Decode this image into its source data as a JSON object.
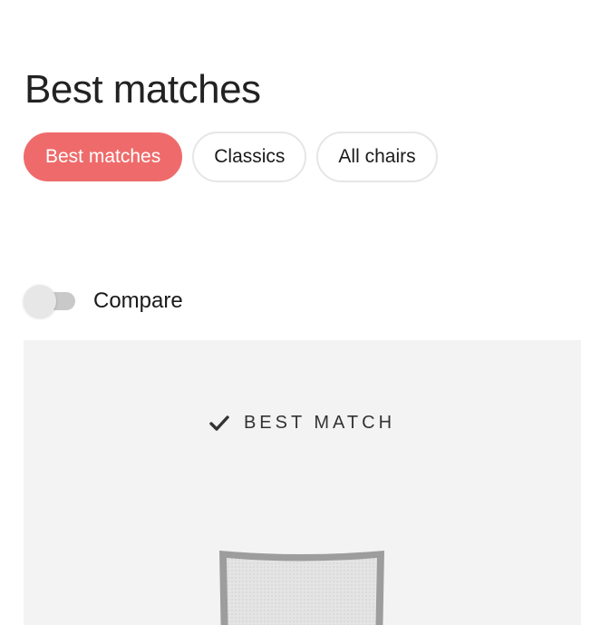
{
  "page": {
    "title": "Best matches"
  },
  "filters": {
    "tabs": [
      {
        "label": "Best matches",
        "active": true
      },
      {
        "label": "Classics",
        "active": false
      },
      {
        "label": "All chairs",
        "active": false
      }
    ]
  },
  "compare": {
    "label": "Compare",
    "enabled": false
  },
  "product_card": {
    "badge_label": "BEST MATCH",
    "badge_icon": "checkmark-icon",
    "image": "office-chair-mesh-back"
  },
  "colors": {
    "accent": "#ef6b6b",
    "card_background": "#f3f3f3",
    "toggle_track": "#c9c9c9"
  }
}
